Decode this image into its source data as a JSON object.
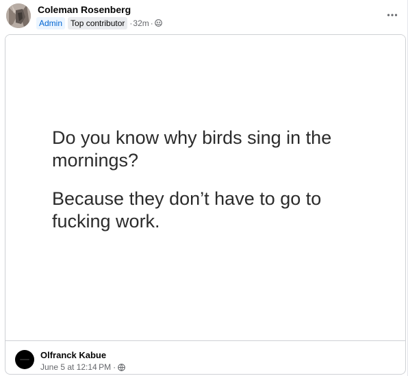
{
  "post": {
    "author": "Coleman Rosenberg",
    "badges": {
      "admin": "Admin",
      "top": "Top contributor"
    },
    "time": "32m",
    "separator": "·",
    "audience_icon": "group-icon",
    "more_icon": "more-options-icon"
  },
  "shared": {
    "meme_lines": [
      "Do you know why birds sing in the",
      "mornings?",
      "Because they don’t have to go to",
      "fucking work."
    ],
    "author": "Olfranck Kabue",
    "time": "June 5 at 12:14 PM",
    "separator": "·",
    "audience_icon": "globe-icon"
  },
  "colors": {
    "admin_badge_bg": "#ebf5ff",
    "admin_badge_text": "#0064d1",
    "meta_text": "#65676b",
    "border": "#ced0d4"
  }
}
